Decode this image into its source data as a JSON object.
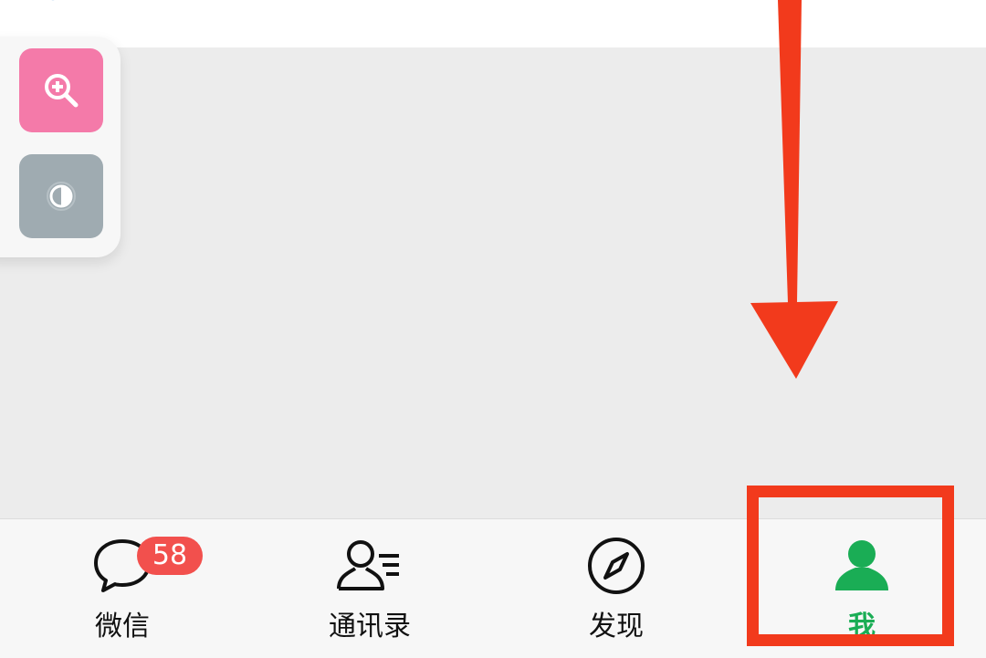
{
  "floating_toolbar": {
    "zoom_icon": "zoom-in-icon",
    "contrast_icon": "contrast-icon",
    "colors": {
      "zoom_bg": "#f47aa9",
      "contrast_bg": "#9fabb1"
    }
  },
  "tabbar": {
    "tabs": [
      {
        "label": "微信",
        "icon": "chat-bubble-icon",
        "badge": "58",
        "active": false
      },
      {
        "label": "通讯录",
        "icon": "contacts-icon",
        "active": false
      },
      {
        "label": "发现",
        "icon": "compass-icon",
        "active": false
      },
      {
        "label": "我",
        "icon": "person-icon",
        "active": true
      }
    ],
    "colors": {
      "active": "#1aad55",
      "inactive": "#111111",
      "badge": "#f2504d"
    }
  },
  "annotation": {
    "arrow_icon": "down-arrow-icon",
    "highlight_color": "#f23a1c"
  }
}
